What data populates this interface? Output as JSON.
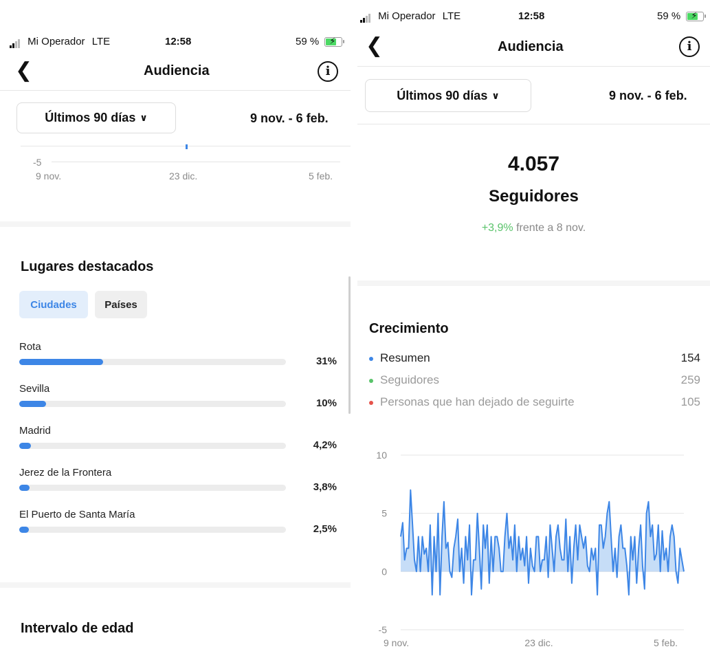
{
  "left": {
    "status": {
      "carrier": "Mi Operador",
      "network": "LTE",
      "time": "12:58",
      "battery": "59 %"
    },
    "header": {
      "title": "Audiencia",
      "back_icon": "chevron-left-icon",
      "info_icon": "info-icon",
      "info_glyph": "i"
    },
    "range": {
      "label": "Últimos 90 días",
      "dates": "9 nov. - 6 feb."
    },
    "mini_chart": {
      "y_tick": "-5",
      "x_ticks": [
        "9 nov.",
        "23 dic.",
        "5 feb."
      ]
    },
    "places": {
      "title": "Lugares destacados",
      "tabs": [
        {
          "label": "Ciudades",
          "active": true
        },
        {
          "label": "Países",
          "active": false
        }
      ],
      "cities": [
        {
          "name": "Rota",
          "pct": "31%",
          "value": 0.31
        },
        {
          "name": "Sevilla",
          "pct": "10%",
          "value": 0.1
        },
        {
          "name": "Madrid",
          "pct": "4,2%",
          "value": 0.042
        },
        {
          "name": "Jerez de la Frontera",
          "pct": "3,8%",
          "value": 0.038
        },
        {
          "name": "El Puerto de Santa María",
          "pct": "2,5%",
          "value": 0.025
        }
      ]
    },
    "age": {
      "title": "Intervalo de edad"
    }
  },
  "right": {
    "status": {
      "carrier": "Mi Operador",
      "network": "LTE",
      "time": "12:58",
      "battery": "59 %"
    },
    "header": {
      "title": "Audiencia",
      "back_icon": "chevron-left-icon",
      "info_icon": "info-icon",
      "info_glyph": "i"
    },
    "range": {
      "label": "Últimos 90 días",
      "dates": "9 nov. - 6 feb."
    },
    "followers": {
      "count": "4.057",
      "label": "Seguidores",
      "change": "+3,9%",
      "change_suffix": " frente a 8 nov."
    },
    "growth": {
      "title": "Crecimiento",
      "legend": [
        {
          "label": "Resumen",
          "value": "154",
          "color": "#3d86e6"
        },
        {
          "label": "Seguidores",
          "value": "259",
          "color": "#59c36a"
        },
        {
          "label": "Personas que han dejado de seguirte",
          "value": "105",
          "color": "#e5534b"
        }
      ]
    }
  },
  "chart_data": {
    "type": "area",
    "title": "",
    "xlabel": "",
    "ylabel": "",
    "y_ticks": [
      "10",
      "5",
      "0",
      "-5"
    ],
    "x_ticks": [
      "9 nov.",
      "23 dic.",
      "5 feb."
    ],
    "ylim": [
      -5,
      10
    ],
    "grid": true,
    "series": [
      {
        "color": "#3d86e6",
        "values": [
          3,
          4.2,
          1,
          2,
          2,
          7,
          4,
          1,
          0,
          3,
          0,
          3,
          1.5,
          2,
          0,
          4,
          -2,
          3,
          0,
          5,
          -2,
          3,
          6,
          2,
          2.5,
          0,
          -0.5,
          2,
          3,
          4.5,
          0,
          2,
          -1,
          3,
          1,
          4,
          -2,
          1,
          1,
          5,
          2,
          -1.5,
          4,
          2,
          4,
          -1,
          3,
          0,
          3,
          3,
          2,
          0,
          0,
          3,
          5,
          2,
          3,
          1,
          4,
          0,
          3,
          1,
          2,
          0.5,
          3,
          -1,
          2,
          0.5,
          0,
          3,
          3,
          0,
          1,
          1,
          3,
          -0.5,
          4,
          2,
          0,
          3,
          4,
          2,
          1,
          1,
          4.5,
          0,
          3,
          -1,
          2,
          4,
          1,
          4,
          3,
          2,
          3,
          0.5,
          0,
          2,
          1,
          2,
          -2,
          4,
          4,
          2,
          3,
          5,
          6,
          3,
          0,
          2,
          -0.5,
          3,
          4,
          2,
          2,
          0.5,
          -2,
          3,
          1,
          3,
          -1,
          2,
          4,
          0.5,
          -1.5,
          5,
          6,
          3,
          4,
          1,
          1.5,
          4,
          0,
          3.5,
          1,
          2,
          0,
          3,
          4,
          3,
          0,
          -1,
          2,
          1,
          0
        ]
      }
    ]
  }
}
